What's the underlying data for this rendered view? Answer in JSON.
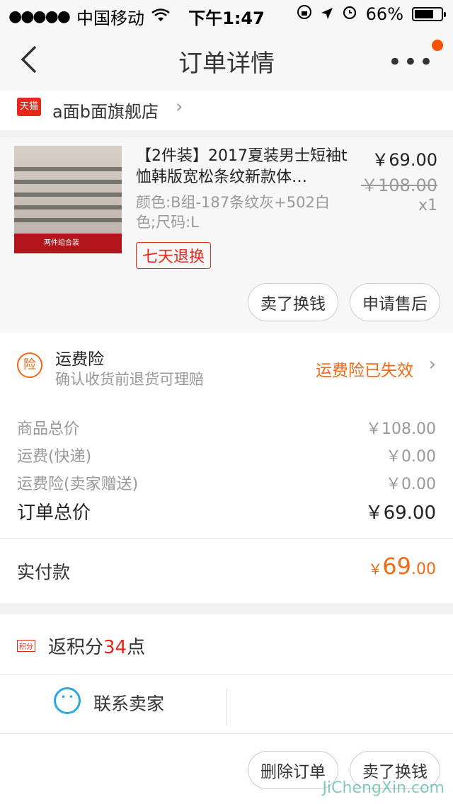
{
  "status_bar": {
    "carrier": "中国移动",
    "time": "下午1:47",
    "battery": "66%"
  },
  "nav": {
    "title": "订单详情",
    "more_label": "•••"
  },
  "shop": {
    "badge": "天猫",
    "name": "a面b面旗舰店"
  },
  "product": {
    "title": "【2件装】2017夏装男士短袖t恤韩版宽松条纹新款体…",
    "sku": "颜色:B组-187条纹灰+502白色;尺码:L",
    "tag": "七天退换",
    "price": "￥69.00",
    "original_price": "￥108.00",
    "quantity": "x1",
    "thumb_caption": "两件组合装"
  },
  "product_actions": {
    "sell_label": "卖了换钱",
    "aftersale_label": "申请售后"
  },
  "insurance": {
    "icon_text": "险",
    "title": "运费险",
    "subtitle": "确认收货前退货可理赔",
    "status": "运费险已失效"
  },
  "cost": {
    "rows": [
      {
        "label": "商品总价",
        "value": "￥108.00"
      },
      {
        "label": "运费(快递)",
        "value": "￥0.00"
      },
      {
        "label": "运费险(卖家赠送)",
        "value": "￥0.00"
      }
    ],
    "total_label": "订单总价",
    "total_value": "￥69.00"
  },
  "payment": {
    "label": "实付款",
    "yen": "￥",
    "int": "69",
    "dec": ".00"
  },
  "points": {
    "icon_text": "积分",
    "prefix": "返积分",
    "count": "34",
    "suffix": "点"
  },
  "contact": {
    "label": "联系卖家"
  },
  "footer": {
    "delete_label": "删除订单",
    "sell_label": "卖了换钱"
  },
  "watermark": "JiChengXin.com"
}
